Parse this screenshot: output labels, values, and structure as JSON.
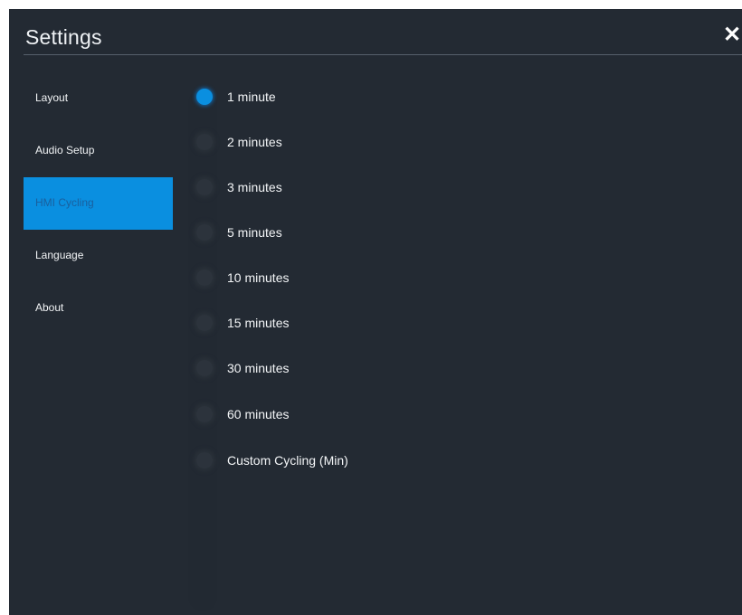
{
  "header": {
    "title": "Settings",
    "close_icon": "close-icon"
  },
  "sidebar": {
    "items": [
      {
        "label": "Layout",
        "active": false
      },
      {
        "label": "Audio Setup",
        "active": false
      },
      {
        "label": "HMI Cycling",
        "active": true
      },
      {
        "label": "Language",
        "active": false
      },
      {
        "label": "About",
        "active": false
      }
    ]
  },
  "options": {
    "selected": "1 minute",
    "items": [
      {
        "label": "1 minute",
        "selected": true
      },
      {
        "label": "2 minutes",
        "selected": false
      },
      {
        "label": "3 minutes",
        "selected": false
      },
      {
        "label": "5 minutes",
        "selected": false
      },
      {
        "label": "10 minutes",
        "selected": false
      },
      {
        "label": "15 minutes",
        "selected": false
      },
      {
        "label": "30 minutes",
        "selected": false
      },
      {
        "label": "60 minutes",
        "selected": false
      },
      {
        "label": "Custom Cycling (Min)",
        "selected": false
      }
    ]
  },
  "colors": {
    "background": "#232a33",
    "accent": "#0a8fe0",
    "text": "#f2f4f6"
  }
}
